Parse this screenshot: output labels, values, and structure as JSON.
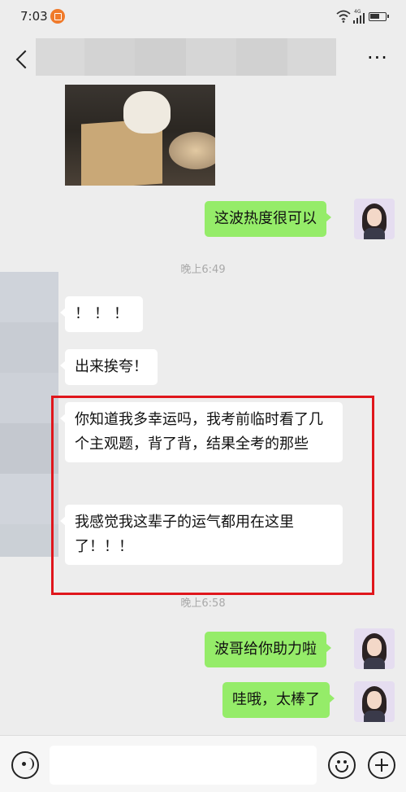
{
  "status_bar": {
    "time": "7:03",
    "network": "4G",
    "icons": [
      "notification-icon",
      "wifi-icon",
      "signal-icon",
      "battery-icon"
    ]
  },
  "header": {
    "title": "",
    "back_icon": "chevron-left-icon",
    "more_label": "···"
  },
  "chat": {
    "image_message": {
      "sender": "other",
      "description_icon": "dog-photo"
    },
    "messages": [
      {
        "sender": "me",
        "text": "这波热度很可以"
      },
      {
        "type": "time",
        "text": "晚上6:49"
      },
      {
        "sender": "other",
        "text": "！！！"
      },
      {
        "sender": "other",
        "text": "出来挨夸！"
      },
      {
        "sender": "other",
        "text": "你知道我多幸运吗，我考前临时看了几个主观题，背了背，结果全考的那些"
      },
      {
        "sender": "other",
        "text": "我感觉我这辈子的运气都用在这里了！！！"
      },
      {
        "type": "time",
        "text": "晚上6:58"
      },
      {
        "sender": "me",
        "text": "波哥给你助力啦"
      },
      {
        "sender": "me",
        "text": "哇哦，太棒了"
      }
    ]
  },
  "annotation": {
    "highlight_color": "#e0161c"
  },
  "colors": {
    "my_bubble": "#95ec69",
    "other_bubble": "#ffffff",
    "background": "#ededed"
  },
  "input_bar": {
    "placeholder": "",
    "voice_icon": "voice-icon",
    "emoji_icon": "emoji-icon",
    "add_icon": "plus-circle-icon"
  }
}
